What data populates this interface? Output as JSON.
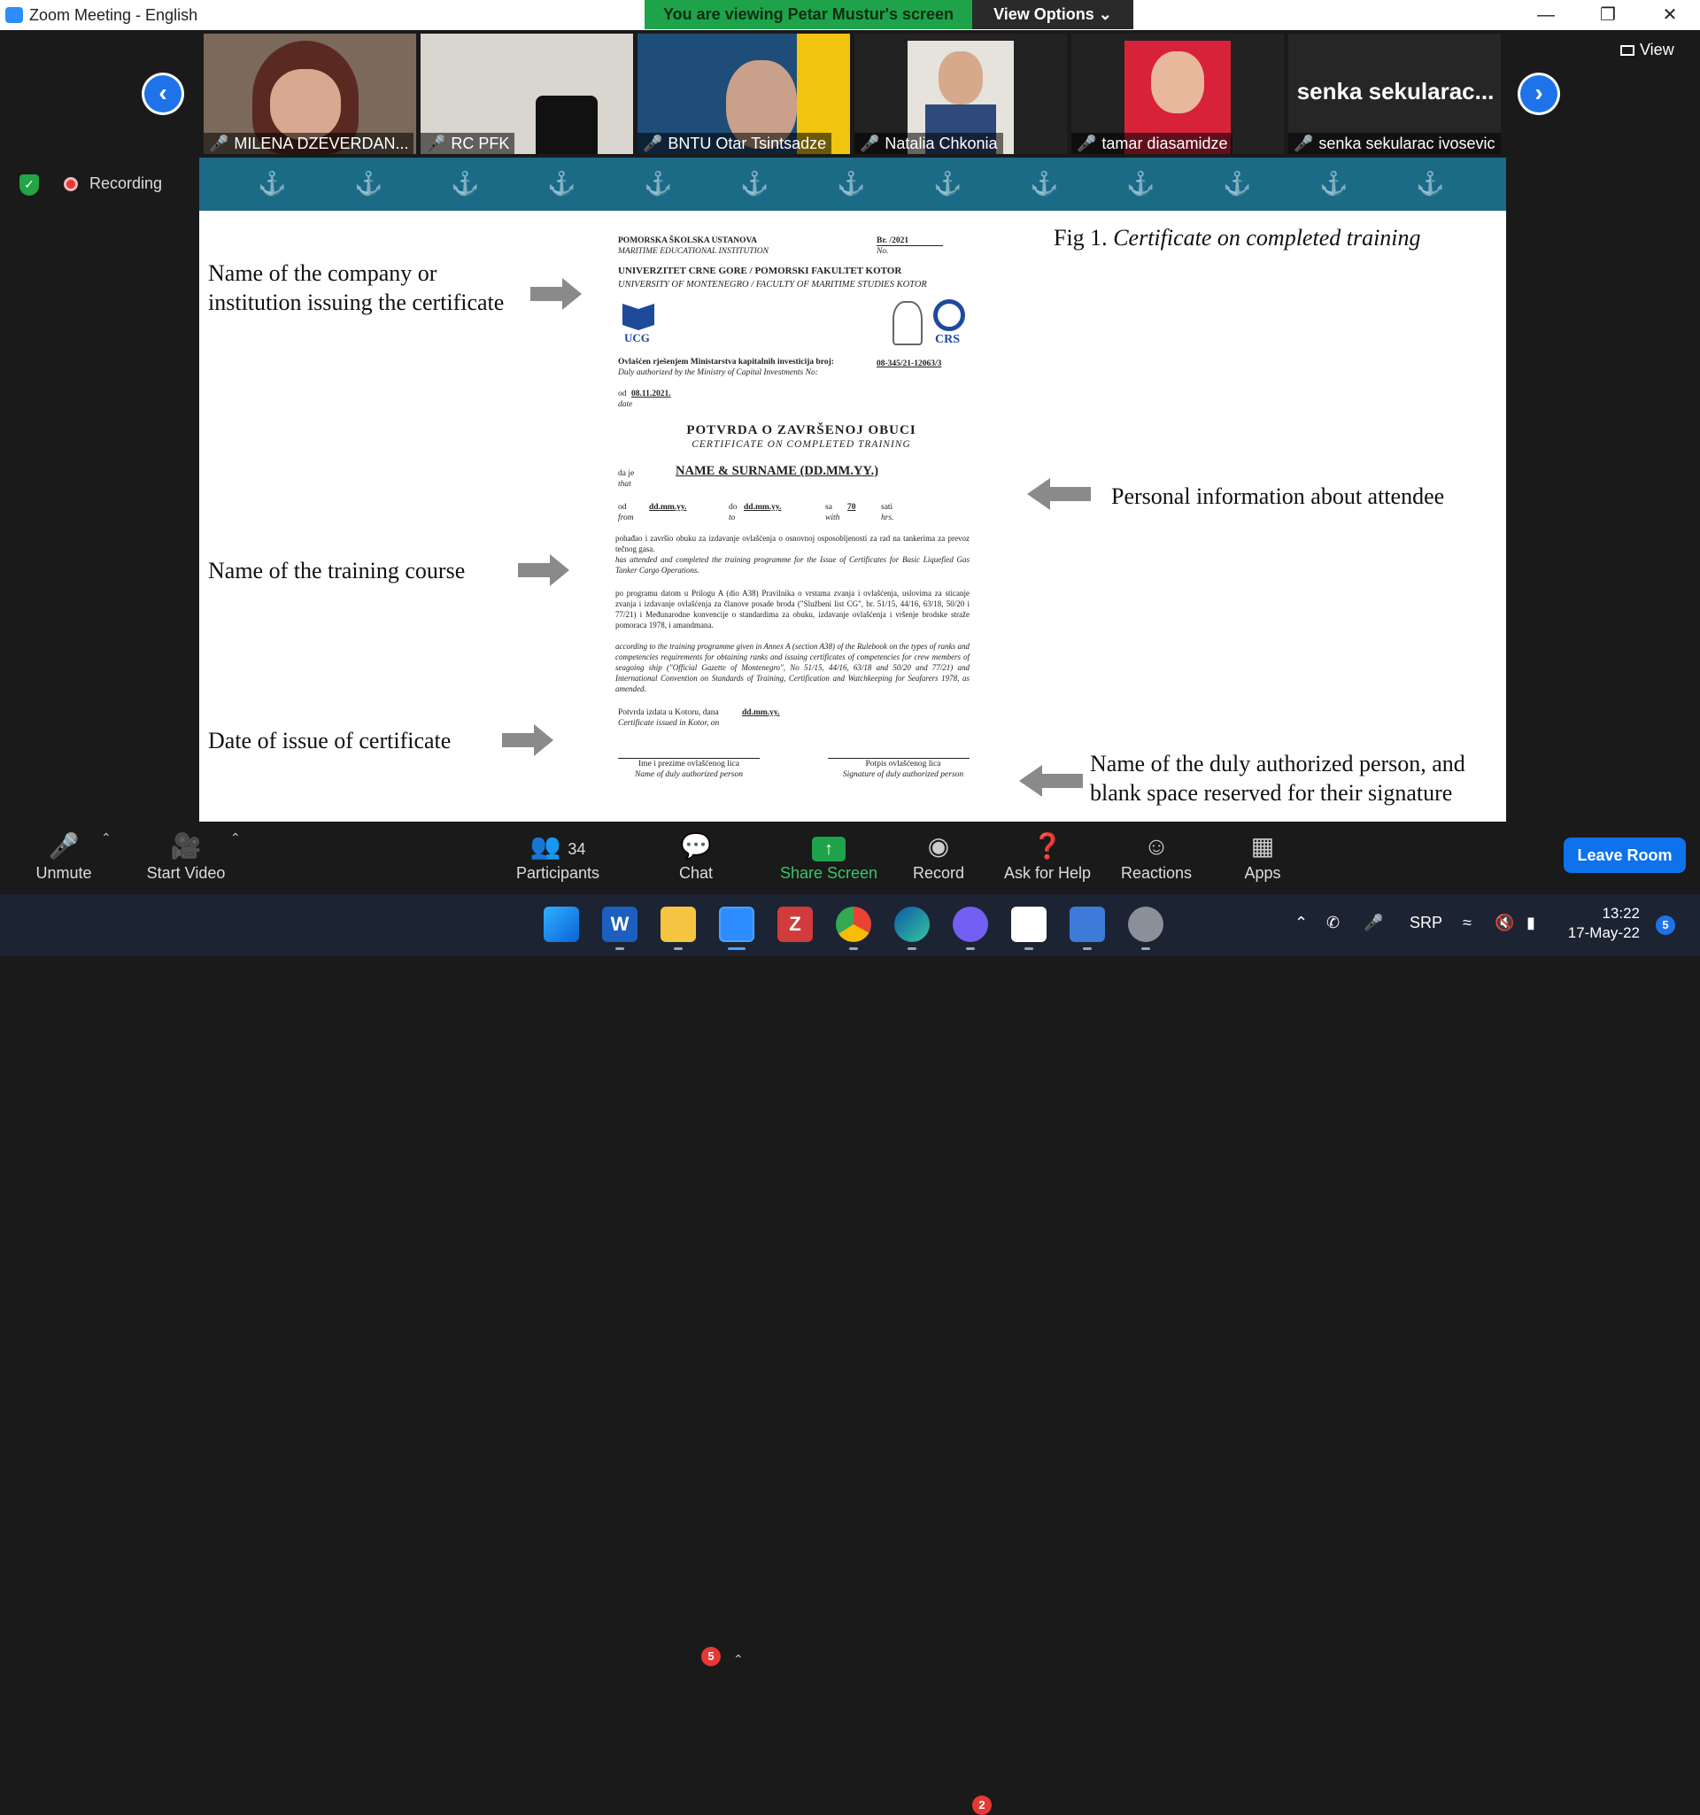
{
  "window": {
    "title": "Zoom Meeting - English"
  },
  "banner": {
    "text": "You are viewing Petar Mustur's screen",
    "view_options": "View Options ⌄"
  },
  "view_button": "View",
  "participants_strip": [
    {
      "name": "MILENA DZEVERDAN..."
    },
    {
      "name": "RC PFK"
    },
    {
      "name": "BNTU Otar Tsintsadze"
    },
    {
      "name": "Natalia Chkonia"
    },
    {
      "name": "tamar diasamidze"
    },
    {
      "name": "senka sekularac ivosevic",
      "tile_text": "senka  sekularac..."
    }
  ],
  "status": {
    "recording": "Recording"
  },
  "slide": {
    "fig_title_plain": "Fig 1. ",
    "fig_title_italic": "Certificate on completed training",
    "annotations": {
      "company": "Name of the company or institution issuing the certificate",
      "personal": "Personal information about attendee",
      "course": "Name of the training course",
      "date": "Date of issue of certificate",
      "authorized": "Name of the duly authorized person, and blank space reserved for their signature"
    },
    "certificate": {
      "inst_hr": "POMORSKA ŠKOLSKA USTANOVA",
      "inst_en": "MARITIME EDUCATIONAL INSTITUTION",
      "br": "Br. /2021",
      "no": "No.",
      "univ_hr": "UNIVERZITET CRNE GORE / POMORSKI FAKULTET KOTOR",
      "univ_en": "UNIVERSITY OF MONTENEGRO / FACULTY OF MARITIME STUDIES KOTOR",
      "ucg": "UCG",
      "crs": "CRS",
      "auth_hr": "Ovlašćen rješenjem Ministarstva kapitalnih investicija broj:",
      "auth_en": "Duly authorized by the Ministry of Capital Investments No:",
      "auth_no": "08-345/21-12063/3",
      "od": "od",
      "od_date": "08.11.2021.",
      "date": "date",
      "heading_hr": "POTVRDA  O  ZAVRŠENOJ  OBUCI",
      "heading_en": "CERTIFICATE  ON  COMPLETED  TRAINING",
      "da_je": "da je",
      "that": "that",
      "name": "NAME & SURNAME (DD.MM.YY.)",
      "from_lbl": "od",
      "from_en": "from",
      "from_val": "dd.mm.yy.",
      "to_lbl": "do",
      "to_en": "to",
      "to_val": "dd.mm.yy.",
      "sa": "sa",
      "with": "with",
      "hours": "70",
      "sati": "sati",
      "hrs": "hrs.",
      "course_hr": "pohađao i završio obuku za izdavanje ovlašćenja o osnovnoj osposobljenosti za rad na tankerima za prevoz tečnog gasa.",
      "course_en": "has attended and completed the training programme for the Issue of Certificates for Basic Liquefied Gas Tanker Cargo Operations.",
      "prog_hr": "po programu datom u Prilogu A (dio A38) Pravilnika o vrstama zvanja i ovlašćenja, uslovima za sticanje zvanja i izdavanje ovlašćenja za članove posade broda (\"Službeni list CG\", br. 51/15, 44/16, 63/18, 50/20 i 77/21) i Međunarodne konvencije o standardima za obuku, izdavanje ovlašćenja i vršenje brodske straže pomoraca 1978, i amandmana.",
      "prog_en": "according to the training programme given in Annex A (section A38) of the Rulebook on the types of ranks and competencies requirements for obtaining ranks and issuing certificates of competencies for crew members of seagoing ship (\"Official Gazette of Montenegro\", No 51/15, 44/16, 63/18 and 50/20 and 77/21) and International Convention on Standards of Training, Certification and Watchkeeping for Seafarers 1978, as amended.",
      "issued_hr": "Potvrda izdata u Kotoru, dana",
      "issued_en": "Certificate issued in Kotor, on",
      "issued_val": "dd.mm.yy.",
      "sig_left_hr": "Ime i prezime ovlašćenog lica",
      "sig_left_en": "Name of duly authorized person",
      "sig_right_hr": "Potpis ovlašćenog lica",
      "sig_right_en": "Signature of duly authorized person"
    }
  },
  "toolbar": {
    "unmute": "Unmute",
    "start_video": "Start Video",
    "participants": "Participants",
    "participants_count": "34",
    "chat": "Chat",
    "chat_badge": "5",
    "share": "Share Screen",
    "record": "Record",
    "help": "Ask for Help",
    "reactions": "Reactions",
    "apps": "Apps",
    "leave": "Leave Room"
  },
  "taskbar": {
    "lang": "SRP",
    "time": "13:22",
    "date": "17-May-22",
    "notif_count": "5",
    "viber_badge": "2"
  },
  "colors": {
    "zoom_blue": "#0e72ed",
    "share_green": "#1ea34a",
    "slide_band": "#1b6a86"
  }
}
